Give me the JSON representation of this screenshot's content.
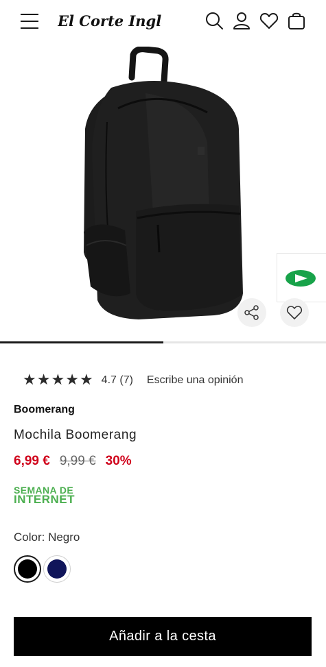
{
  "header": {
    "logo_text": "El Corte Inglés",
    "icons": [
      "menu-icon",
      "search-icon",
      "user-icon",
      "heart-icon",
      "bag-icon"
    ]
  },
  "gallery": {
    "image_progress_fraction": 0.5,
    "promo_badge_icon": "green-arrow-badge-icon"
  },
  "rating": {
    "stars": [
      "★",
      "★",
      "★",
      "★",
      "★"
    ],
    "summary": "4.7 (7)",
    "write_review": "Escribe una opinión"
  },
  "product": {
    "brand": "Boomerang",
    "title": "Mochila Boomerang",
    "price_now": "6,99 €",
    "price_old": "9,99 €",
    "discount": "30%",
    "promo_line1": "SEMANA DE",
    "promo_line2": "INTERNET"
  },
  "color": {
    "label": "Color: Negro",
    "swatches": [
      {
        "name": "Negro",
        "hex": "#000000",
        "selected": true
      },
      {
        "name": "Azul marino",
        "hex": "#10155a",
        "selected": false
      }
    ]
  },
  "actions": {
    "add_to_cart": "Añadir a la cesta"
  },
  "colors": {
    "accent_price": "#d0021b",
    "promo_green": "#4caf50",
    "button_bg": "#000000"
  }
}
